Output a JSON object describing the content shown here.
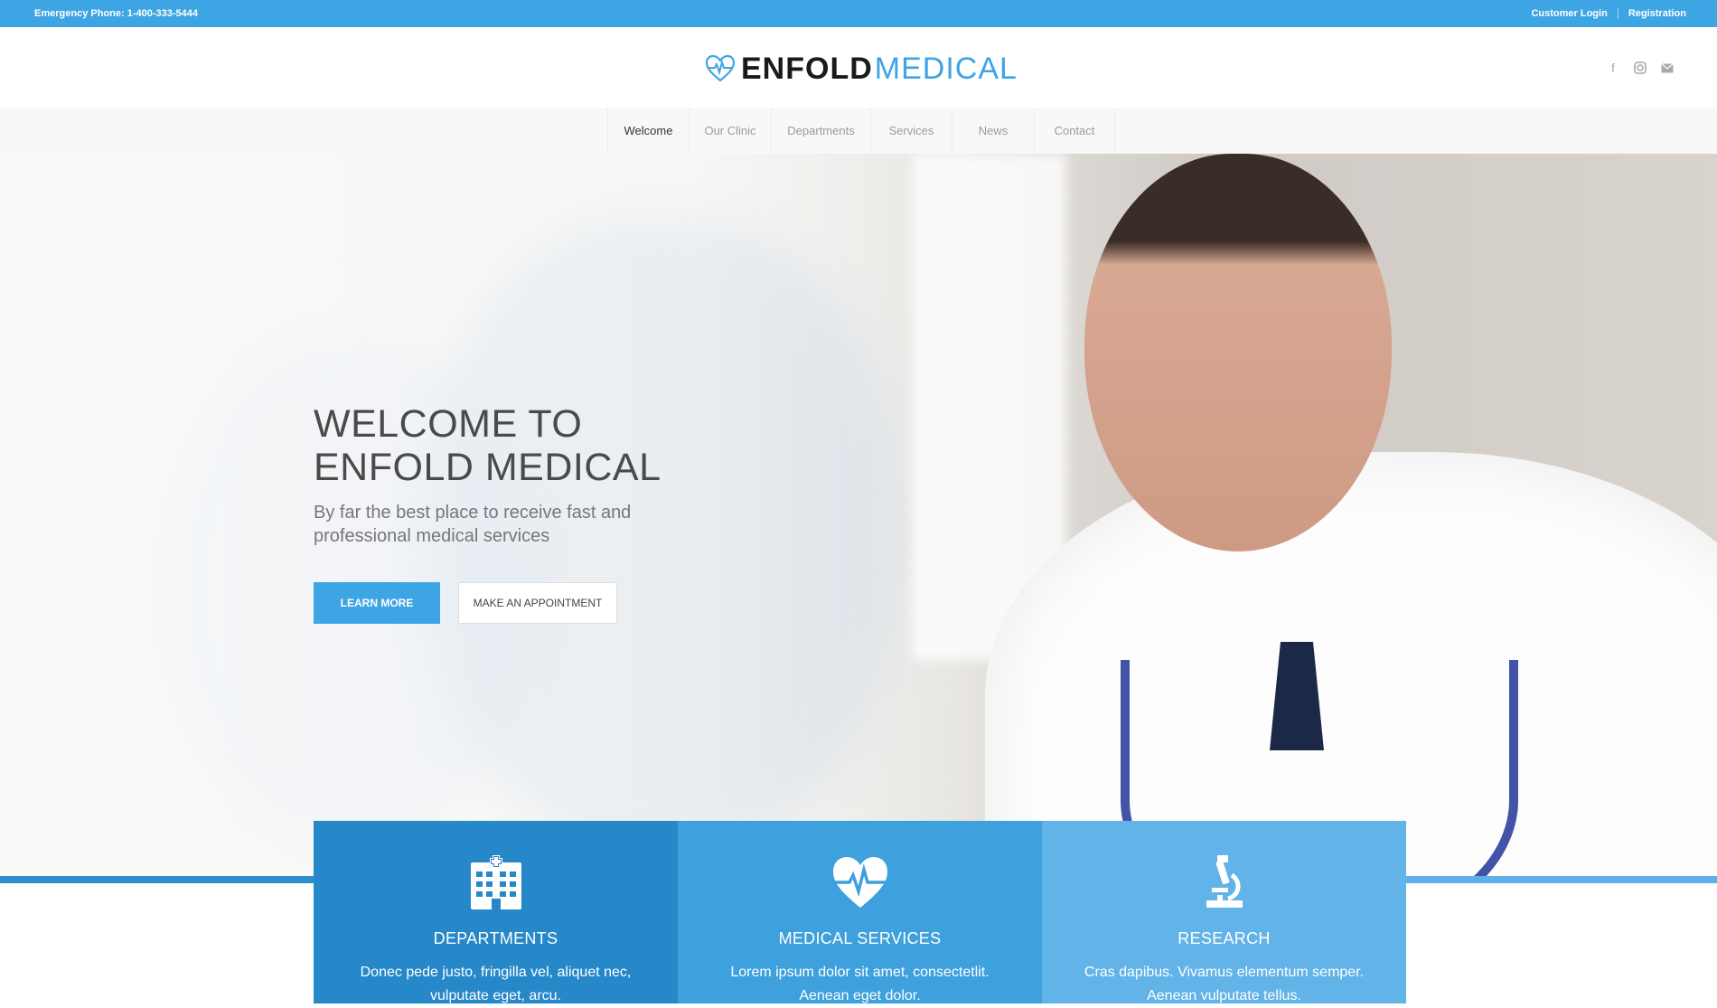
{
  "topbar": {
    "phone": "Emergency Phone: 1-400-333-5444",
    "customer_login": "Customer Login",
    "registration": "Registration"
  },
  "logo": {
    "bold": "ENFOLD",
    "light": "MEDICAL"
  },
  "social": [
    "facebook-icon",
    "instagram-icon",
    "mail-icon"
  ],
  "nav": {
    "items": [
      {
        "label": "Welcome",
        "active": true
      },
      {
        "label": "Our Clinic"
      },
      {
        "label": "Departments"
      },
      {
        "label": "Services"
      },
      {
        "label": "News"
      },
      {
        "label": "Contact"
      }
    ]
  },
  "hero": {
    "title_line1": "WELCOME TO",
    "title_line2": "ENFOLD MEDICAL",
    "subtitle": "By far the best place to receive fast and professional medical services",
    "learn_more": "LEARN MORE",
    "appointment": "MAKE AN APPOINTMENT"
  },
  "features": [
    {
      "icon": "hospital-icon",
      "title": "DEPARTMENTS",
      "text": "Donec pede justo, fringilla vel, aliquet nec, vulputate eget, arcu."
    },
    {
      "icon": "heartbeat-icon",
      "title": "MEDICAL SERVICES",
      "text": "Lorem ipsum dolor sit amet, consectetlit. Aenean eget dolor."
    },
    {
      "icon": "microscope-icon",
      "title": "RESEARCH",
      "text": "Cras dapibus. Vivamus elementum semper. Aenean vulputate tellus."
    }
  ],
  "colors": {
    "accent": "#3ea5e4",
    "feature1": "#2688c8",
    "feature2": "#3ea0dc",
    "feature3": "#62b3e7"
  }
}
